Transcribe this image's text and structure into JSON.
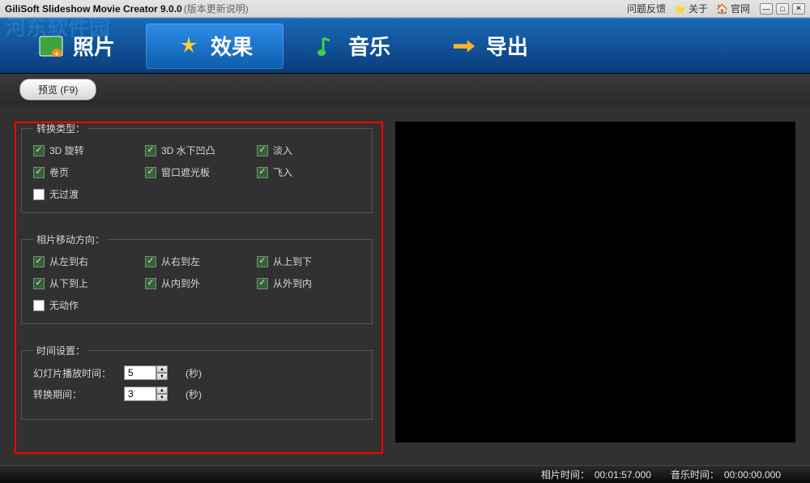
{
  "titlebar": {
    "title": "GiliSoft Slideshow Movie Creator 9.0.0",
    "subtitle": "(版本更新说明)",
    "links": {
      "feedback": "问题反馈",
      "about": "关于",
      "homepage": "官网"
    }
  },
  "nav": {
    "photo": "照片",
    "effect": "效果",
    "music": "音乐",
    "export": "导出"
  },
  "toolbar": {
    "preview": "预览 (F9)"
  },
  "transition": {
    "legend": "转换类型：",
    "rotate3d": "3D 旋转",
    "underwater3d": "3D 水下凹凸",
    "fadein": "淡入",
    "pageturn": "卷页",
    "windowblind": "窗口遮光板",
    "flyin": "飞入",
    "notransition": "无过渡"
  },
  "movement": {
    "legend": "相片移动方向：",
    "l2r": "从左到右",
    "r2l": "从右到左",
    "t2b": "从上到下",
    "b2t": "从下到上",
    "i2o": "从内到外",
    "o2i": "从外到内",
    "none": "无动作"
  },
  "timing": {
    "legend": "时间设置：",
    "slide_label": "幻灯片播放时间：",
    "slide_val": "5",
    "trans_label": "转换期间：",
    "trans_val": "3",
    "unit": "(秒)"
  },
  "status": {
    "photo_label": "相片时间：",
    "photo_val": "00:01:57.000",
    "music_label": "音乐时间：",
    "music_val": "00:00:00.000"
  },
  "watermark": "河东软件园"
}
